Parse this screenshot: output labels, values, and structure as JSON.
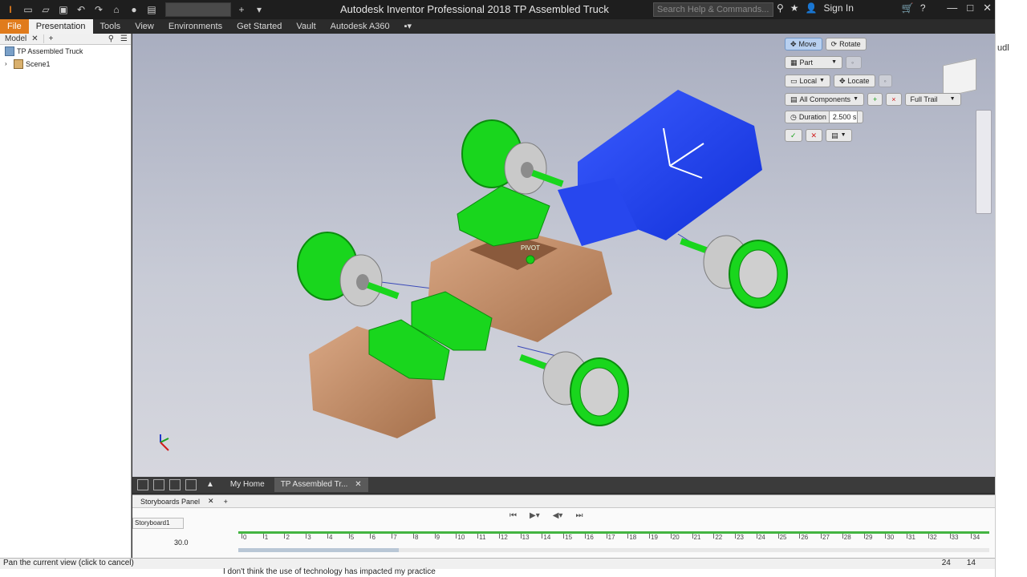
{
  "window": {
    "title": "Autodesk Inventor Professional 2018   TP Assembled Truck",
    "search_placeholder": "Search Help & Commands...",
    "sign_in": "Sign In"
  },
  "ribbon": {
    "tabs": [
      {
        "label": "File"
      },
      {
        "label": "Presentation"
      },
      {
        "label": "Tools"
      },
      {
        "label": "View"
      },
      {
        "label": "Environments"
      },
      {
        "label": "Get Started"
      },
      {
        "label": "Vault"
      },
      {
        "label": "Autodesk A360"
      }
    ]
  },
  "browser": {
    "tab_label": "Model",
    "items": [
      {
        "label": "TP Assembled Truck"
      },
      {
        "label": "Scene1"
      }
    ]
  },
  "viewport": {
    "pivot_label": "PIVOT"
  },
  "mini_toolbar": {
    "move": "Move",
    "rotate": "Rotate",
    "part": "Part",
    "local": "Local",
    "locate": "Locate",
    "all_components": "All Components",
    "full_trail": "Full Trail",
    "duration_label": "Duration",
    "duration_value": "2.500 s"
  },
  "doc_tabs": {
    "home": "My Home",
    "doc": "TP Assembled Tr..."
  },
  "storyboard": {
    "panel_label": "Storyboards Panel",
    "storyboard_tab": "Storyboard1",
    "time_value": "30.0",
    "ticks": [
      "0",
      "1",
      "2",
      "3",
      "4",
      "5",
      "6",
      "7",
      "8",
      "9",
      "10",
      "11",
      "12",
      "13",
      "14",
      "15",
      "16",
      "17",
      "18",
      "19",
      "20",
      "21",
      "22",
      "23",
      "24",
      "25",
      "26",
      "27",
      "28",
      "29",
      "30",
      "31",
      "32",
      "33",
      "34"
    ]
  },
  "status": {
    "text": "Pan the current view (click to cancel)",
    "num1": "24",
    "num2": "14",
    "under_text": "I don't think the use of technology has impacted my practice"
  },
  "side_strip": {
    "text": "udl"
  }
}
